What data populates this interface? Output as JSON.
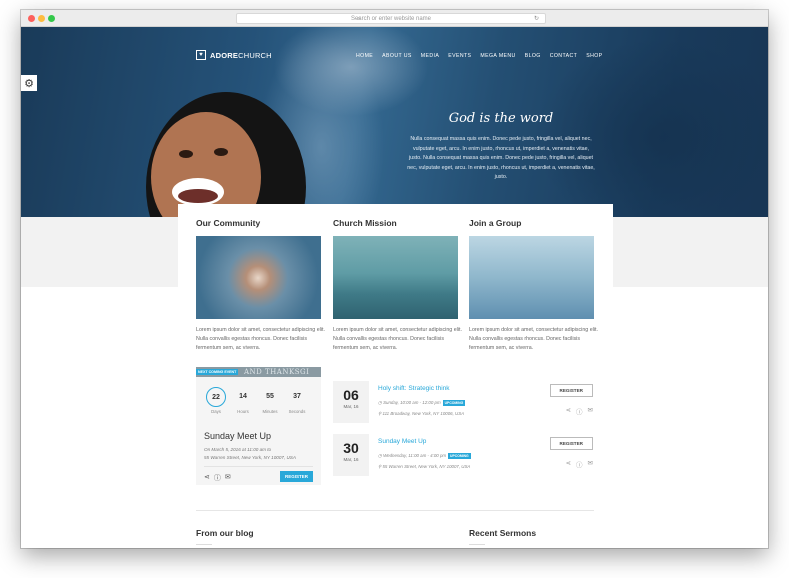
{
  "browser": {
    "url_placeholder": "Search or enter website name"
  },
  "site": {
    "logo_bold": "ADORE",
    "logo_light": "CHURCH",
    "nav": [
      "HOME",
      "ABOUT US",
      "MEDIA",
      "EVENTS",
      "MEGA MENU",
      "BLOG",
      "CONTACT",
      "SHOP"
    ]
  },
  "hero": {
    "title": "God is the word",
    "text": "Nulla consequat massa quis enim. Donec pede justo, fringilla vel, aliquet nec, vulputate eget, arcu. In enim justo, rhoncus ut, imperdiet a, venenatis vitae, justo. Nulla consequat massa quis enim. Donec pede justo, fringilla vel, aliquet nec, vulputate eget, arcu. In enim justo, rhoncus ut, imperdiet a, venenatis vitae, justo."
  },
  "columns": [
    {
      "title": "Our Community",
      "text": "Lorem ipsum dolor sit amet, consectetur adipiscing elit. Nulla convallis egestas rhoncus. Donec facilisis fermentum sem, ac viverra."
    },
    {
      "title": "Church Mission",
      "text": "Lorem ipsum dolor sit amet, consectetur adipiscing elit. Nulla convallis egestas rhoncus. Donec facilisis fermentum sem, ac viverra."
    },
    {
      "title": "Join a Group",
      "text": "Lorem ipsum dolor sit amet, consectetur adipiscing elit. Nulla convallis egestas rhoncus. Donec facilisis fermentum sem, ac viverra."
    }
  ],
  "next_event": {
    "tag": "NEXT COMING EVENT",
    "strip_text": "AND THANKSGI",
    "countdown": [
      {
        "value": "22",
        "label": "Days"
      },
      {
        "value": "14",
        "label": "Hours"
      },
      {
        "value": "55",
        "label": "Minutes"
      },
      {
        "value": "37",
        "label": "Seconds"
      }
    ],
    "name": "Sunday Meet Up",
    "when": "On March 5, 2016 at 11:00 am to",
    "where": "55 Warren Street, New York, NY 10007, USA",
    "register": "REGISTER"
  },
  "events": [
    {
      "day": "06",
      "month": "Mar, 16",
      "title": "Holy shift: Strategic think",
      "time": "Sunday, 10:00 am - 12:00 pm",
      "badge": "UPCOMING",
      "address": "111 Broadway, New York, NY 10006, USA",
      "register": "REGISTER"
    },
    {
      "day": "30",
      "month": "Mar, 16",
      "title": "Sunday Meet Up",
      "time": "Wednesday, 11:00 am - 4:00 pm",
      "badge": "UPCOMING",
      "address": "55 Warren Street, New York, NY 10007, USA",
      "register": "REGISTER"
    }
  ],
  "sections": {
    "blog": "From our blog",
    "sermons": "Recent Sermons"
  }
}
